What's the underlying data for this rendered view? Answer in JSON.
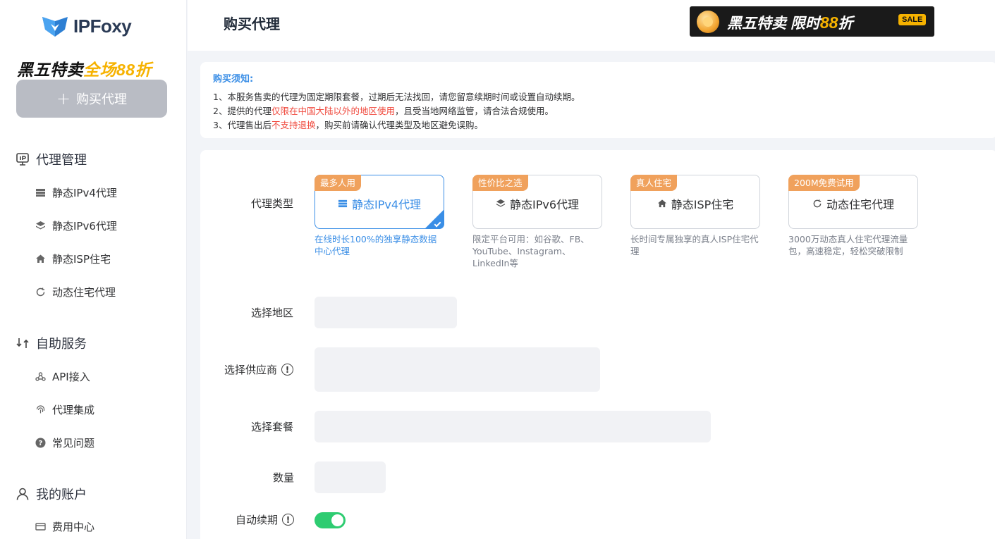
{
  "brand": {
    "name": "IPFoxy"
  },
  "sidebar": {
    "promo_a": "黑五特卖",
    "promo_b": "全场88折",
    "buy_button": "购买代理",
    "groups": [
      {
        "label": "代理管理",
        "icon": "ip-icon"
      },
      {
        "label": "自助服务",
        "icon": "exchange-icon"
      },
      {
        "label": "我的账户",
        "icon": "user-icon"
      }
    ],
    "items": [
      {
        "label": "静态IPv4代理",
        "icon": "server-icon"
      },
      {
        "label": "静态IPv6代理",
        "icon": "layers-icon"
      },
      {
        "label": "静态ISP住宅",
        "icon": "home-icon"
      },
      {
        "label": "动态住宅代理",
        "icon": "refresh-icon"
      },
      {
        "label": "API接入",
        "icon": "webhook-icon"
      },
      {
        "label": "代理集成",
        "icon": "fingerprint-icon"
      },
      {
        "label": "常见问题",
        "icon": "question-icon"
      },
      {
        "label": "费用中心",
        "icon": "card-icon"
      }
    ]
  },
  "header": {
    "title": "购买代理",
    "banner": {
      "part1": "黑五特卖 限时",
      "part2": "88",
      "part3": "折",
      "sale": "SALE"
    }
  },
  "notice": {
    "title": "购买须知:",
    "line1": "1、本服务售卖的代理为固定期限套餐，过期后无法找回，请您留意续期时间或设置自动续期。",
    "line2_a": "2、提供的代理",
    "line2_red": "仅限在中国大陆以外的地区使用",
    "line2_b": "，且受当地网络监管，请合法合规使用。",
    "line3_a": "3、代理售出后",
    "line3_red": "不支持退换",
    "line3_b": "，购买前请确认代理类型及地区避免误购。"
  },
  "form": {
    "type_label": "代理类型",
    "region_label": "选择地区",
    "provider_label": "选择供应商",
    "plan_label": "选择套餐",
    "qty_label": "数量",
    "auto_renew_label": "自动续期",
    "auto_renew_on": true,
    "cards": [
      {
        "tag": "最多人用",
        "name": "静态IPv4代理",
        "desc": "在线时长100%的独享静态数据中心代理",
        "selected": true
      },
      {
        "tag": "性价比之选",
        "name": "静态IPv6代理",
        "desc": "限定平台可用：如谷歌、FB、YouTube、Instagram、LinkedIn等",
        "selected": false
      },
      {
        "tag": "真人住宅",
        "name": "静态ISP住宅",
        "desc": "长时间专属独享的真人ISP住宅代理",
        "selected": false
      },
      {
        "tag": "200M免费试用",
        "name": "动态住宅代理",
        "desc": "3000万动态真人住宅代理流量包，高速稳定，轻松突破限制",
        "selected": false
      }
    ]
  },
  "colors": {
    "accent": "#3a8ee6",
    "tag": "#f0a15c",
    "toggle": "#2ecc71",
    "warn": "#f04a3e"
  }
}
